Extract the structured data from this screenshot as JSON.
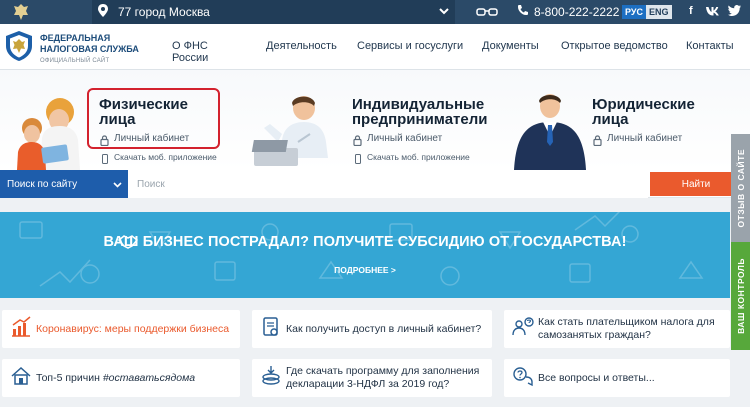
{
  "topbar": {
    "region": "77 город Москва",
    "phone": "8-800-222-2222",
    "lang_ru": "РУС",
    "lang_en": "ENG",
    "social": [
      "f",
      "vk",
      "twitter"
    ]
  },
  "logo": {
    "line1": "ФЕДЕРАЛЬНАЯ",
    "line2": "НАЛОГОВАЯ СЛУЖБА",
    "subtitle": "ОФИЦИАЛЬНЫЙ САЙТ"
  },
  "nav": [
    "О ФНС России",
    "Деятельность",
    "Сервисы и госуслуги",
    "Документы",
    "Открытое ведомство",
    "Контакты"
  ],
  "hero": {
    "individuals": {
      "title1": "Физические",
      "title2": "лица",
      "account": "Личный кабинет",
      "app": "Скачать моб. приложение"
    },
    "entrepreneurs": {
      "title1": "Индивидуальные",
      "title2": "предприниматели",
      "account": "Личный кабинет",
      "app": "Скачать моб. приложение"
    },
    "legal": {
      "title1": "Юридические",
      "title2": "лица",
      "account": "Личный кабинет"
    }
  },
  "search": {
    "scope": "Поиск по сайту",
    "placeholder": "Поиск",
    "button": "Найти"
  },
  "banner": {
    "title": "ВАШ БИЗНЕС ПОСТРАДАЛ? ПОЛУЧИТЕ СУБСИДИЮ ОТ ГОСУДАРСТВА!",
    "more": "ПОДРОБНЕЕ >"
  },
  "cards": [
    {
      "text": "Коронавирус: меры поддержки бизнеса"
    },
    {
      "text": "Как получить доступ в личный кабинет?"
    },
    {
      "text1": "Как стать плательщиком налога для",
      "text2": "самозанятых граждан?"
    },
    {
      "text1": "Топ-5 причин ",
      "text2": "#оставатьсядома"
    },
    {
      "text1": "Где скачать программу для заполнения",
      "text2": "декларации 3-НДФЛ за 2019 год?"
    },
    {
      "text": "Все вопросы и ответы..."
    }
  ],
  "side_tabs": {
    "feedback": "ОТЗЫВ О САЙТЕ",
    "control": "ВАШ КОНТРОЛЬ"
  },
  "colors": {
    "topbar": "#2b4a68",
    "accent_orange": "#ea5a2d",
    "banner": "#34a6d4",
    "search_scope": "#1e5dab",
    "feedback_tab": "#9aa3ab",
    "control_tab": "#57a83b"
  }
}
